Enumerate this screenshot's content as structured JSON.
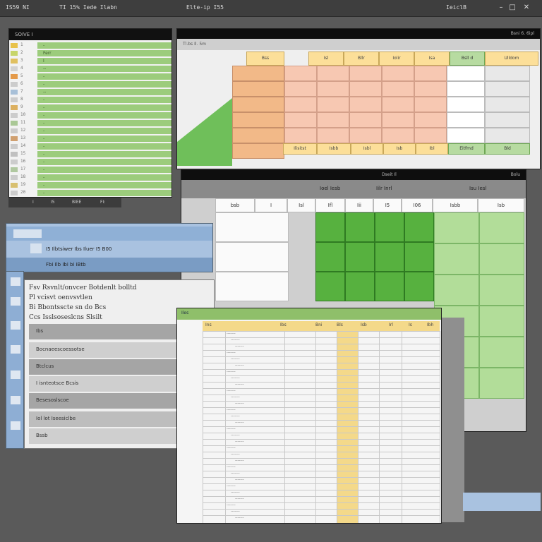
{
  "topbar": {
    "title": "IS59 NI",
    "menu_1": "TI 15% Iede Ilabn",
    "center": "Elte-ip I55",
    "right_text": "IeiclB"
  },
  "win_a": {
    "title": "SOIVE I",
    "rows": [
      {
        "label": "1",
        "text": "-"
      },
      {
        "label": "2",
        "text": "Ferr"
      },
      {
        "label": "3",
        "text": "I"
      },
      {
        "label": "4",
        "text": "--"
      },
      {
        "label": "5",
        "text": "-"
      },
      {
        "label": "6",
        "text": "-"
      },
      {
        "label": "7",
        "text": "--"
      },
      {
        "label": "8",
        "text": "-"
      },
      {
        "label": "9",
        "text": "-"
      },
      {
        "label": "10",
        "text": "-"
      },
      {
        "label": "11",
        "text": "-"
      },
      {
        "label": "12",
        "text": "-"
      },
      {
        "label": "13",
        "text": "-"
      },
      {
        "label": "14",
        "text": "-"
      },
      {
        "label": "15",
        "text": "-"
      },
      {
        "label": "16",
        "text": "-"
      },
      {
        "label": "17",
        "text": "-"
      },
      {
        "label": "18",
        "text": "-"
      },
      {
        "label": "19",
        "text": "-"
      },
      {
        "label": "20",
        "text": "-"
      }
    ],
    "footer": [
      "I",
      "I5",
      "BIEE",
      "FI:"
    ]
  },
  "win_b": {
    "title": "Bsni 6. 6ipl",
    "header_left": "Tl.bs Il. 5m",
    "headers": [
      "Bss",
      "Isl",
      "Bllr",
      "Iolir",
      "Isa",
      "Bsll d",
      "Ulldom"
    ],
    "footer": [
      "Ilisitst",
      "Isbb",
      "Isbl",
      "Isb",
      "Ibl",
      "Eitfmd",
      "Bld"
    ]
  },
  "win_c": {
    "title": "Dseit Il",
    "right": "Bolu",
    "tabs": [
      "Ioel Iesb",
      "Iilr Inrl",
      "Isu Iesl"
    ],
    "headers": [
      "bsb",
      "I",
      "Isl",
      "Ifl",
      "Iii",
      "I5",
      "I06",
      "Isbb",
      "Isb"
    ]
  },
  "win_d": {
    "rows": [
      "I5 Ilbtsiwer Ibs Iluer I5 B00",
      "Fbi Ilb Ibi bi iBtb"
    ]
  },
  "win_f": {
    "lines": [
      "Fsv Rsvnlt/onvcer Botdenlt bolltd",
      "Pl vcisvt oenvsvtlen",
      "Bi Bbontsscte sn do Bcs",
      "Ccs Isslsoseslcns Slsilt"
    ],
    "gbars": [
      "Ibs",
      "Bocnaeescoessotse",
      "Btclcus",
      "I isnteotsce Bcsis",
      "Besesoslscoe",
      "Iol lot Iseesiclbe",
      "Bssb"
    ]
  },
  "win_g": {
    "title": "Iles",
    "headers": [
      "Ins",
      "Ibs",
      "Bni",
      "Bls",
      "Isb",
      "Irl",
      "Is",
      "Ibh"
    ]
  },
  "colors": {
    "green_dark": "#57b13f",
    "green_light": "#b2dd99",
    "yellow": "#fcdf99",
    "pink": "#f7c8b2",
    "blue": "#a9c2e0"
  }
}
